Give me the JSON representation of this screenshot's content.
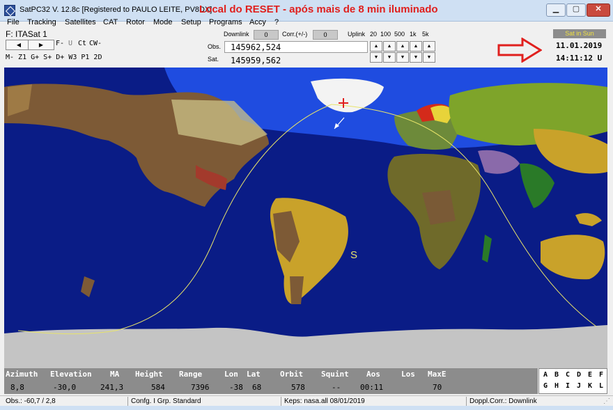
{
  "window": {
    "title": "SatPC32 V. 12.8c  [Registered to PAULO LEITE, PV8DX]",
    "annotation": "Local do RESET - após mais de 8 min iluminado",
    "minimize_glyph": "▁",
    "maximize_glyph": "▢",
    "close_glyph": "✕"
  },
  "menu": [
    "File",
    "Tracking",
    "Satellites",
    "CAT",
    "Rotor",
    "Mode",
    "Setup",
    "Programs",
    "Accy",
    "?"
  ],
  "control": {
    "satellite_label": "F: ITASat 1",
    "mode_row1": [
      "F-",
      "U",
      "Ct",
      "CW-"
    ],
    "mode_row2": "M- Z1 G+ S+ D+ W3 P1 2D",
    "downlink_label": "Downlink",
    "downlink_value": "0",
    "corr_label": "Corr.(+/-)",
    "corr_value": "0",
    "uplink_label": "Uplink",
    "steps": [
      "20",
      "100",
      "500",
      "1k",
      "5k"
    ],
    "obs_label": "Obs.",
    "obs_freq": "145962,524",
    "sat_label": "Sat.",
    "sat_freq": "145959,562",
    "sat_in_sun": "Sat in Sun",
    "date": "11.01.2019",
    "time": "14:11:12 U"
  },
  "map": {
    "sat_marker": "S",
    "qth_marker": "+"
  },
  "data_table": {
    "headers": [
      "Azimuth",
      "Elevation",
      "MA",
      "Height",
      "Range",
      "Lon",
      "Lat",
      "Orbit",
      "Squint",
      "Aos",
      "Los",
      "MaxE"
    ],
    "values": [
      "8,8",
      "-30,0",
      "241,3",
      "584",
      "7396",
      "-38",
      "68",
      "578",
      "--",
      "00:11",
      "",
      "70"
    ]
  },
  "letters": {
    "row1": [
      "A",
      "B",
      "C",
      "D",
      "E",
      "F"
    ],
    "row2": [
      "G",
      "H",
      "I",
      "J",
      "K",
      "L"
    ]
  },
  "status": {
    "obs": "Obs.: -60,7 / 2,8",
    "config": "Confg. I  Grp. Standard",
    "keps": "Keps: nasa.all 08/01/2019",
    "doppler": "Doppl.Corr.: Downlink"
  },
  "colors": {
    "ocean": "#0a1c86",
    "daylight_ocean": "#1f4ce0",
    "antarctica": "#c4c4c4",
    "track": "#e8e46a",
    "annotation_red": "#e0201e"
  }
}
